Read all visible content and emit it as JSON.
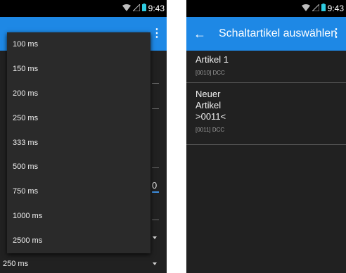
{
  "left": {
    "status_time": "9:43",
    "bottom_value": "250 ms",
    "partial_field_char": "0",
    "dropdown_options": [
      "100 ms",
      "150 ms",
      "200 ms",
      "250 ms",
      "333 ms",
      "500 ms",
      "750 ms",
      "1000 ms",
      "2500 ms"
    ]
  },
  "right": {
    "status_time": "9:43",
    "title": "Schaltartikel auswählen",
    "items": [
      {
        "name_lines": [
          "Artikel 1"
        ],
        "meta": "[0010]  DCC"
      },
      {
        "name_lines": [
          "Neuer",
          "Artikel",
          ">0011<"
        ],
        "meta": "[0011]  DCC"
      }
    ]
  },
  "colors": {
    "appbar": "#1e88e5",
    "background": "#212121",
    "statusbar": "#000000",
    "accent_line": "#3f8fe0"
  },
  "icons": [
    "wifi-icon",
    "signal-icon",
    "battery-icon",
    "back-arrow-icon",
    "overflow-menu-icon",
    "dropdown-caret-icon"
  ]
}
